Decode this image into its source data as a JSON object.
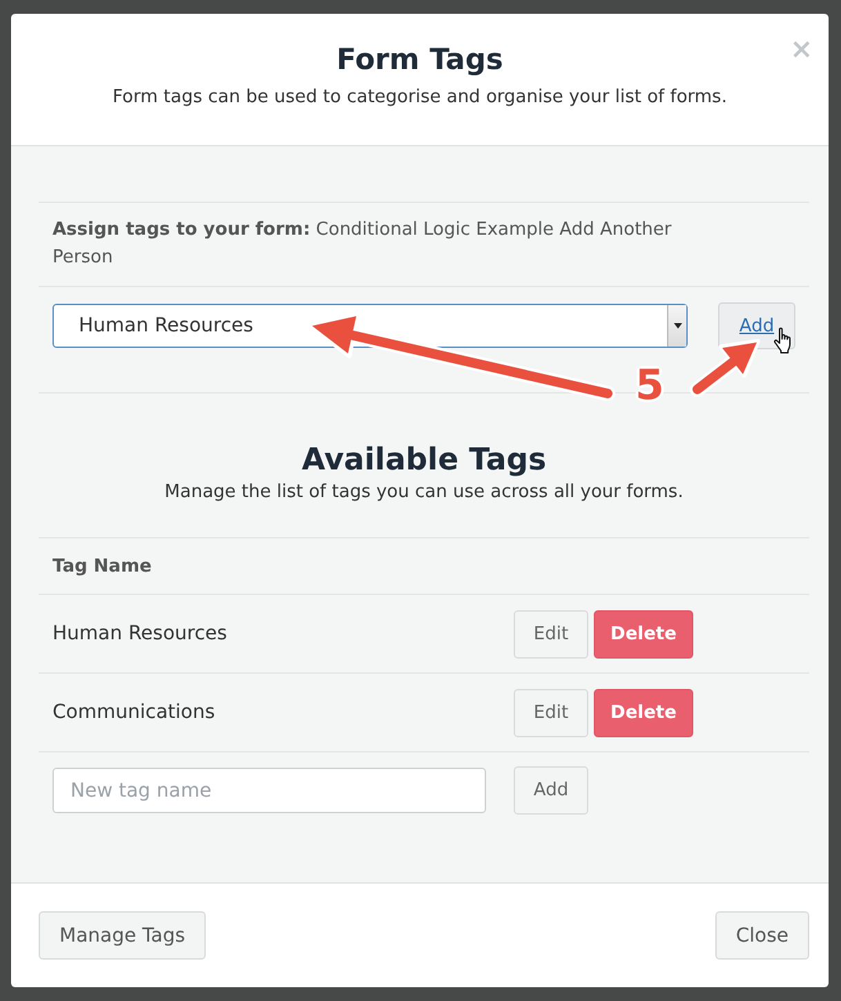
{
  "dialog": {
    "title": "Form Tags",
    "subtitle": "Form tags can be used to categorise and organise your list of forms.",
    "close": "×"
  },
  "assign": {
    "label": "**Assign tags to your form:** Conditional Logic Example Add Another Person",
    "select": {
      "value": "Human Resources"
    },
    "add_button": "Add"
  },
  "available_tags": {
    "title": "Available Tags",
    "subtitle": "Manage the list of tags you can use across all your forms.",
    "column": "Tag Name",
    "tags": [
      {
        "name": "Human Resources",
        "edit": "Edit",
        "delete": "Delete"
      },
      {
        "name": "Communications",
        "edit": "Edit",
        "delete": "Delete"
      }
    ],
    "new_tag": {
      "placeholder": "New tag name",
      "add_button": "Add"
    }
  },
  "footer": {
    "manage_button": "Manage Tags",
    "close_button": "Close"
  },
  "annotation": {
    "step": "5"
  }
}
